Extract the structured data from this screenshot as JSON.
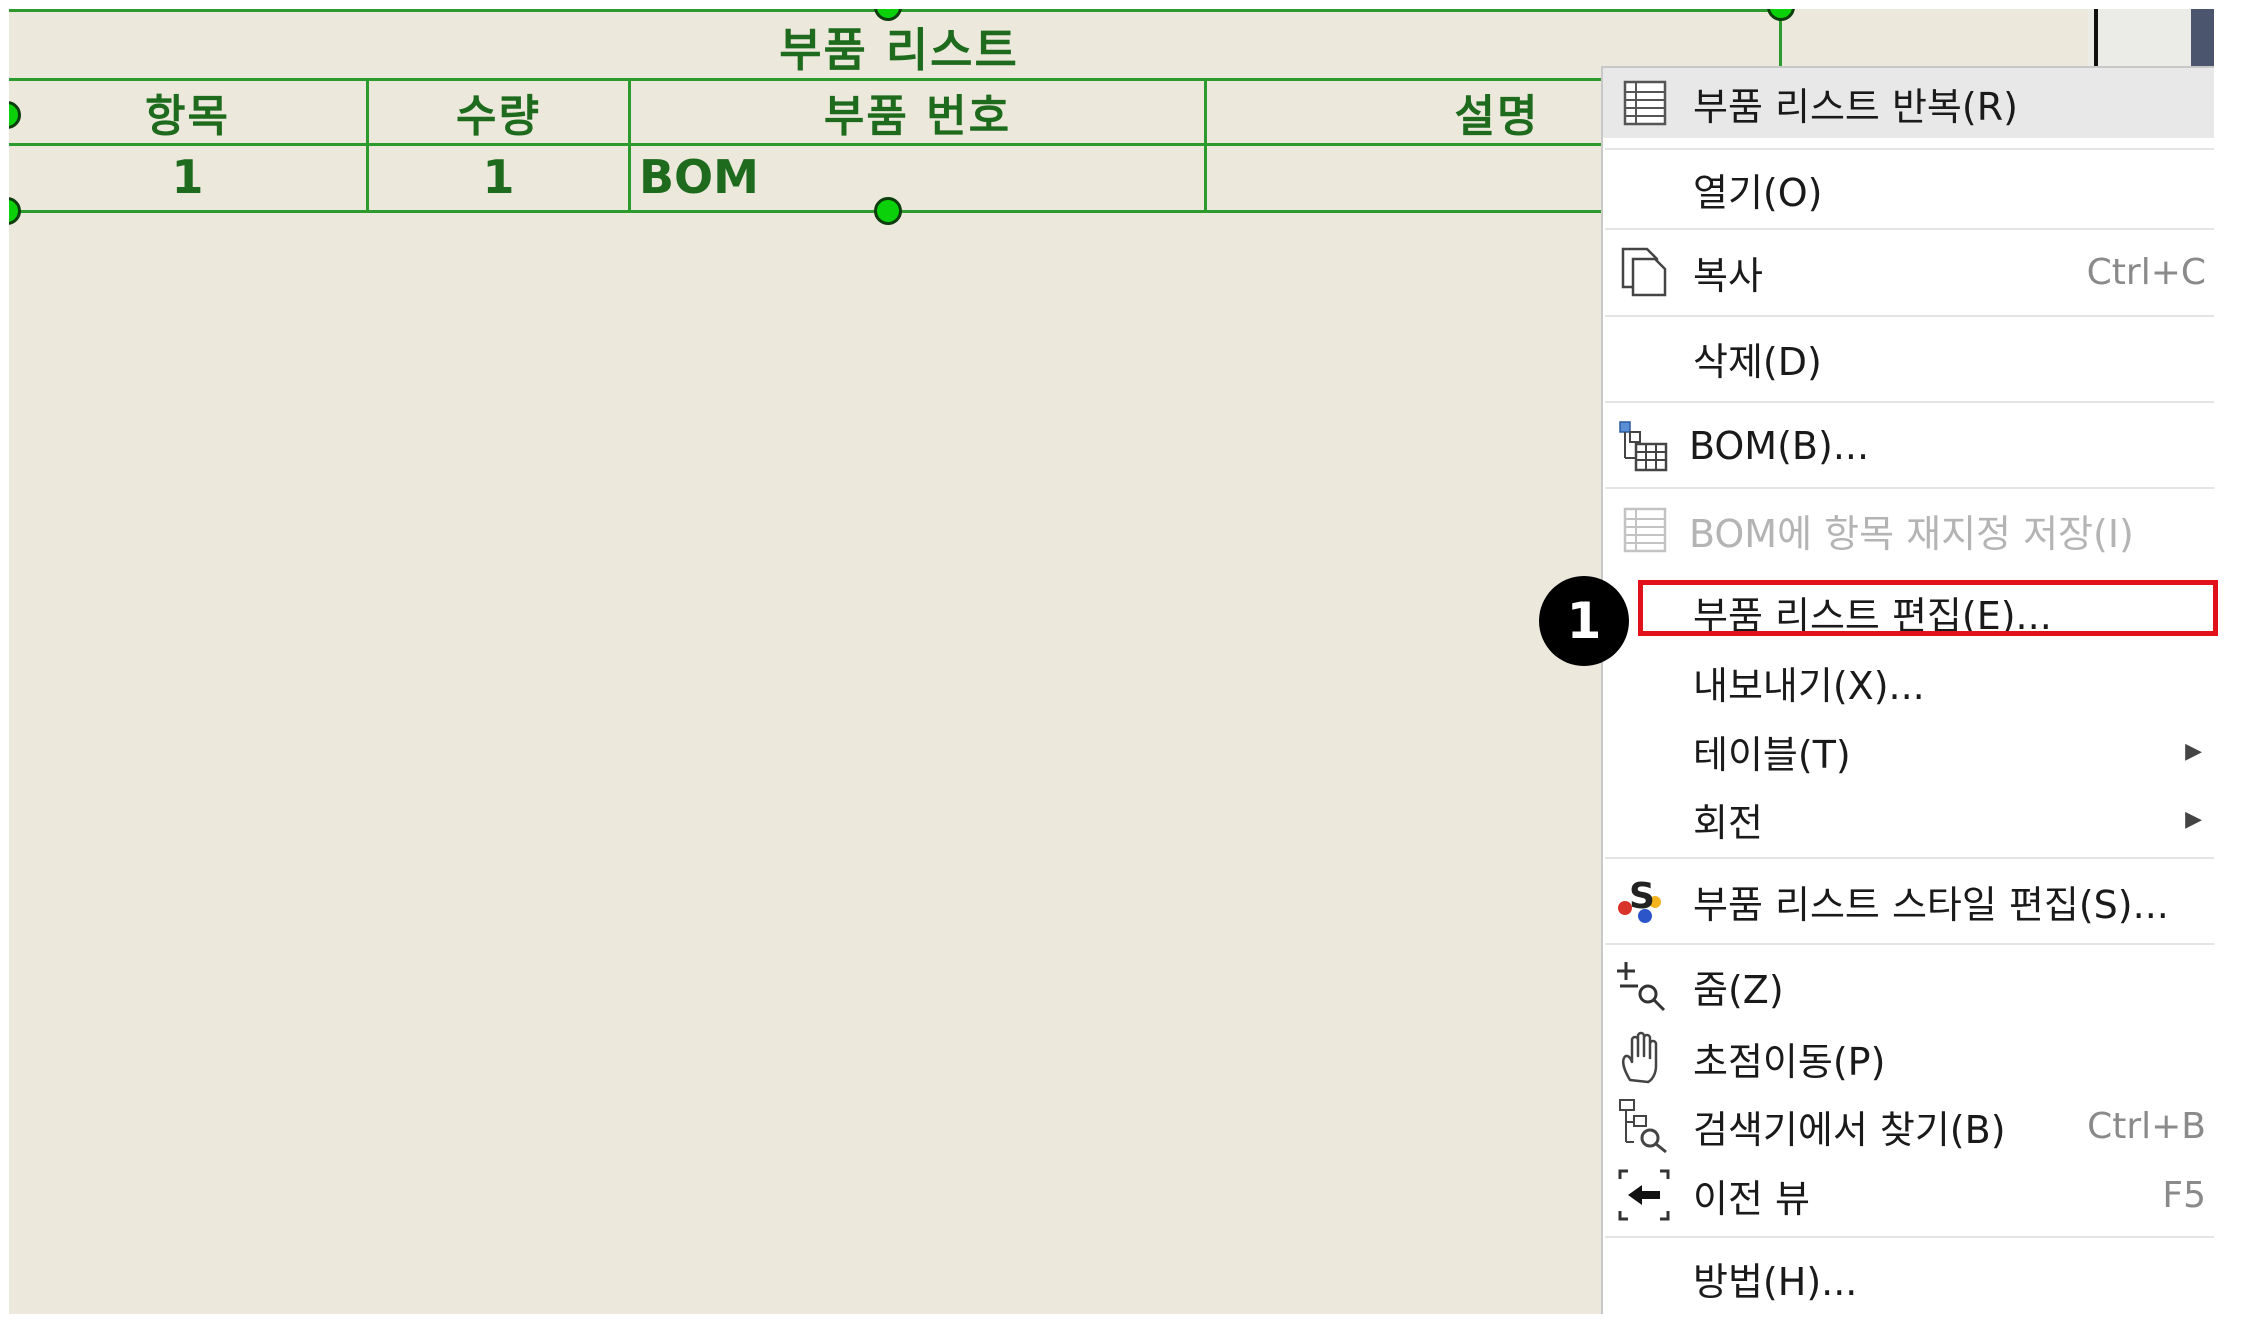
{
  "table": {
    "title": "부품 리스트",
    "headers": [
      "항목",
      "수량",
      "부품 번호",
      "설명"
    ],
    "row": [
      "1",
      "1",
      "BOM",
      ""
    ]
  },
  "menu": {
    "items": [
      {
        "label": "부품 리스트 반복(R)",
        "icon": "table-grid-icon"
      },
      {
        "label": "열기(O)"
      },
      {
        "label": "복사",
        "shortcut": "Ctrl+C",
        "icon": "copy-icon"
      },
      {
        "label": "삭제(D)"
      },
      {
        "label": "BOM(B)...",
        "icon": "bom-icon"
      },
      {
        "label": "BOM에 항목 재지정 저장(I)",
        "icon": "table-grid-icon",
        "disabled": true
      },
      {
        "label": "부품 리스트 편집(E)..."
      },
      {
        "label": "내보내기(X)..."
      },
      {
        "label": "테이블(T)",
        "submenu": true
      },
      {
        "label": "회전",
        "submenu": true
      },
      {
        "label": "부품 리스트 스타일 편집(S)...",
        "icon": "style-icon"
      },
      {
        "label": "줌(Z)",
        "icon": "zoom-icon"
      },
      {
        "label": "초점이동(P)",
        "icon": "hand-pan-icon"
      },
      {
        "label": "검색기에서 찾기(B)",
        "shortcut": "Ctrl+B",
        "icon": "find-in-tree-icon"
      },
      {
        "label": "이전 뷰",
        "shortcut": "F5",
        "icon": "previous-view-icon"
      },
      {
        "label": "방법(H)..."
      }
    ]
  },
  "annotation": {
    "number": "1",
    "color": "#e2121b"
  },
  "colors": {
    "accent_green": "#2c9a2c",
    "canvas": "#ece9dc",
    "highlight": "#e2121b"
  }
}
